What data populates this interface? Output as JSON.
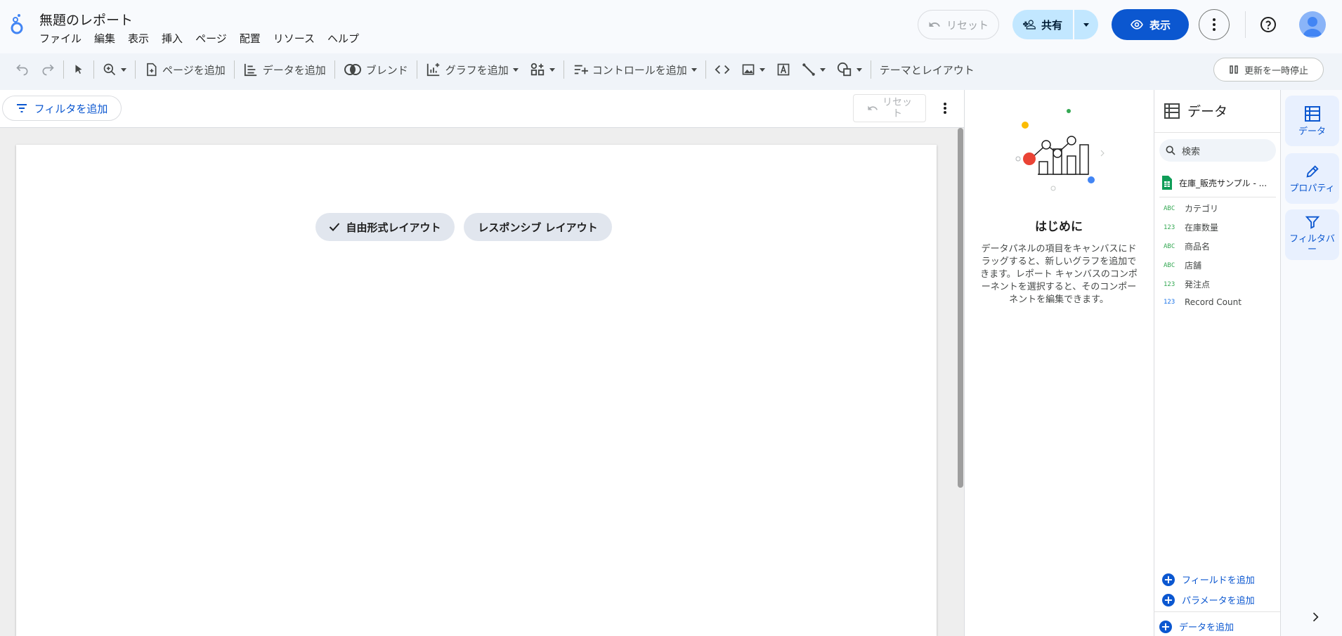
{
  "header": {
    "doc_title": "無題のレポート",
    "menu": [
      "ファイル",
      "編集",
      "表示",
      "挿入",
      "ページ",
      "配置",
      "リソース",
      "ヘルプ"
    ],
    "reset_label": "リセット",
    "share_label": "共有",
    "view_label": "表示"
  },
  "toolbar": {
    "add_page": "ページを追加",
    "add_data": "データを追加",
    "blend": "ブレンド",
    "add_chart": "グラフを追加",
    "add_control": "コントロールを追加",
    "theme_layout": "テーマとレイアウト",
    "pause_updates": "更新を一時停止"
  },
  "filter_bar": {
    "add_filter": "フィルタを追加",
    "reset_line1": "リセッ",
    "reset_line2": "ト"
  },
  "canvas": {
    "chip_free": "自由形式レイアウト",
    "chip_responsive": "レスポンシブ レイアウト"
  },
  "start_panel": {
    "title": "はじめに",
    "body": "データパネルの項目をキャンバスにドラッグすると、新しいグラフを追加できます。レポート キャンバスのコンポーネントを選択すると、そのコンポーネントを編集できます。"
  },
  "data_panel": {
    "title": "データ",
    "search_placeholder": "検索",
    "source_name": "在庫_販売サンプル - ...",
    "fields": [
      {
        "type": "ABC",
        "name": "カテゴリ"
      },
      {
        "type": "123",
        "name": "在庫数量"
      },
      {
        "type": "ABC",
        "name": "商品名"
      },
      {
        "type": "ABC",
        "name": "店舗"
      },
      {
        "type": "123",
        "name": "発注点"
      },
      {
        "type": "123",
        "name": "Record Count"
      }
    ],
    "add_field": "フィールドを追加",
    "add_parameter": "パラメータを追加",
    "add_data": "データを追加"
  },
  "right_rail": {
    "data": "データ",
    "properties": "プロパティ",
    "filter_bar_line1": "フィルタバ",
    "filter_bar_line2": "ー"
  },
  "colors": {
    "accent": "#0b57d0",
    "share_bg": "#c2e7ff",
    "dimension_type": "#34a853",
    "metric_type": "#1a73e8"
  }
}
